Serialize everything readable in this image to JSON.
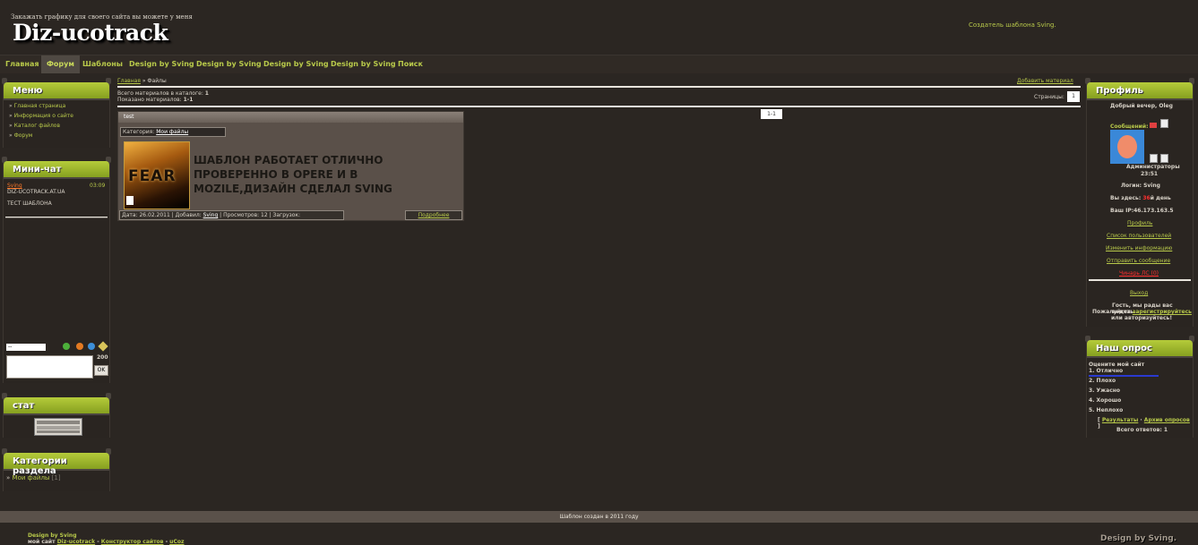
{
  "header": {
    "tagline": "Закажать графику для своего сайта вы можете у меня",
    "logo": "Diz-ucotrack",
    "creator": "Создатель шаблона Sving."
  },
  "nav": [
    "Главная",
    "Форум",
    "Шаблоны",
    "Design by Sving",
    "Design by Sving",
    "Design by Sving",
    "Design by Sving",
    "Поиск"
  ],
  "menu": {
    "title": "Меню",
    "items": [
      "Главная страница",
      "Информация о сайте",
      "Каталог файлов",
      "Форум"
    ]
  },
  "minichat": {
    "title": "Мини-чат",
    "user": "Sving",
    "time": "03:09",
    "site": "DIZ-UCOTRACK.AT.UA",
    "message": "ТЕСТ ШАБЛОНА",
    "name_value": "--",
    "counter": "200",
    "ok": "OK"
  },
  "stat": {
    "title": "стат"
  },
  "categories": {
    "title": "Категории раздела",
    "item": "Мои файлы",
    "count": "[1]"
  },
  "content": {
    "breadcrumb_home": "Главная",
    "breadcrumb_current": "» Файлы",
    "add_material": "Добавить материал",
    "total_label": "Всего материалов в каталоге:",
    "total_value": "1",
    "shown_label": "Показано материалов:",
    "shown_value": "1-1",
    "pages_label": "Страницы:",
    "page_num": "1",
    "range": "1-1",
    "card": {
      "title": "test",
      "category_label": "Категория:",
      "category": "Мои файлы",
      "description": "ШАБЛОН РАБОТАЕТ ОТЛИЧНО ПРОВЕРЕННО В OPERE И В MOZILE,ДИЗАЙН СДЕЛАЛ SVING",
      "poster_text": "FEAR",
      "footer_date": "Дата: 26.02.2011",
      "footer_added": "Добавил:",
      "footer_user": "Sving",
      "footer_views": "Просмотров: 12",
      "footer_downloads": "Загрузок:",
      "more": "Подробнее"
    }
  },
  "profile": {
    "title": "Профиль",
    "greeting": "Добрый вечер, Oleg",
    "messages": "Сообщений:",
    "group": "Администраторы",
    "time": "23:51",
    "login": "Логин: Sving",
    "here_prefix": "Вы здесь:",
    "here_days": "36",
    "here_suffix": "й день",
    "ip": "Ваш IP:46.173.163.5",
    "links": [
      "Профиль",
      "Список пользователей",
      "Изменить информацию",
      "Отправить сообщение"
    ],
    "chat_link": "Чинарь ЛС (0)",
    "exit": "Выход",
    "guest_line1": "Гость, мы рады вас видеть.",
    "guest_line2": "Пожалуйста",
    "guest_register": "зарегистрируйтесь",
    "guest_line3": "или авторизуйтесь!"
  },
  "poll": {
    "title": "Наш опрос",
    "question": "Оцените мой сайт",
    "options": [
      "1. Отлично",
      "2. Плохо",
      "3. Ужасно",
      "4. Хорошо",
      "5. Неплохо"
    ],
    "results": "Результаты",
    "archive": "Архив опросов",
    "total": "Всего ответов: 1",
    "colors": {
      "bar": "#2a3ad0"
    }
  },
  "footer": {
    "bar": "Шаблон создан в 2011 году",
    "design": "Design by Sving",
    "mysite": "мой сайт",
    "site_link": "Diz-ucotrack",
    "constructor": "Конструктор сайтов",
    "ucoz": "uCoz",
    "sep": "-",
    "badge": "Design by Sving."
  },
  "colors": {
    "accent": "#b8c94a",
    "bg": "#2b2622",
    "header_green": "#9ab52d"
  }
}
